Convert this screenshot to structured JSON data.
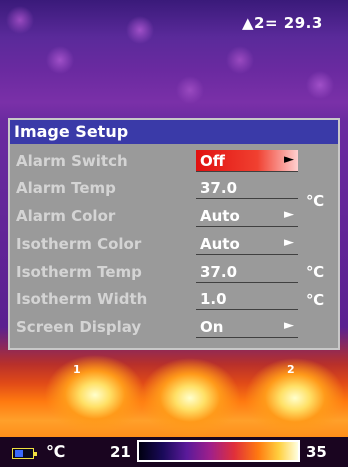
{
  "header": {
    "spot_label": "▲2=",
    "spot_value": "29.3"
  },
  "markers": {
    "left": "1",
    "right": "2"
  },
  "menu": {
    "title": "Image Setup",
    "items": [
      {
        "label": "Alarm Switch",
        "value": "Off",
        "has_arrow": true,
        "unit": ""
      },
      {
        "label": "Alarm Temp",
        "value": "37.0",
        "has_arrow": false,
        "unit": "℃"
      },
      {
        "label": "Alarm Color",
        "value": "Auto",
        "has_arrow": true,
        "unit": ""
      },
      {
        "label": "Isotherm Color",
        "value": "Auto",
        "has_arrow": true,
        "unit": ""
      },
      {
        "label": "Isotherm Temp",
        "value": "37.0",
        "has_arrow": false,
        "unit": "℃"
      },
      {
        "label": "Isotherm Width",
        "value": "1.0",
        "has_arrow": false,
        "unit": "℃"
      },
      {
        "label": "Screen Display",
        "value": "On",
        "has_arrow": true,
        "unit": ""
      }
    ],
    "arrow_glyph": "►"
  },
  "statusbar": {
    "unit": "℃",
    "range_min": "21",
    "range_max": "35"
  },
  "colors": {
    "menu_title_bg": "#3a3aa8",
    "menu_bg": "#9a9a9a",
    "selected_value_bg": "#e01010"
  }
}
